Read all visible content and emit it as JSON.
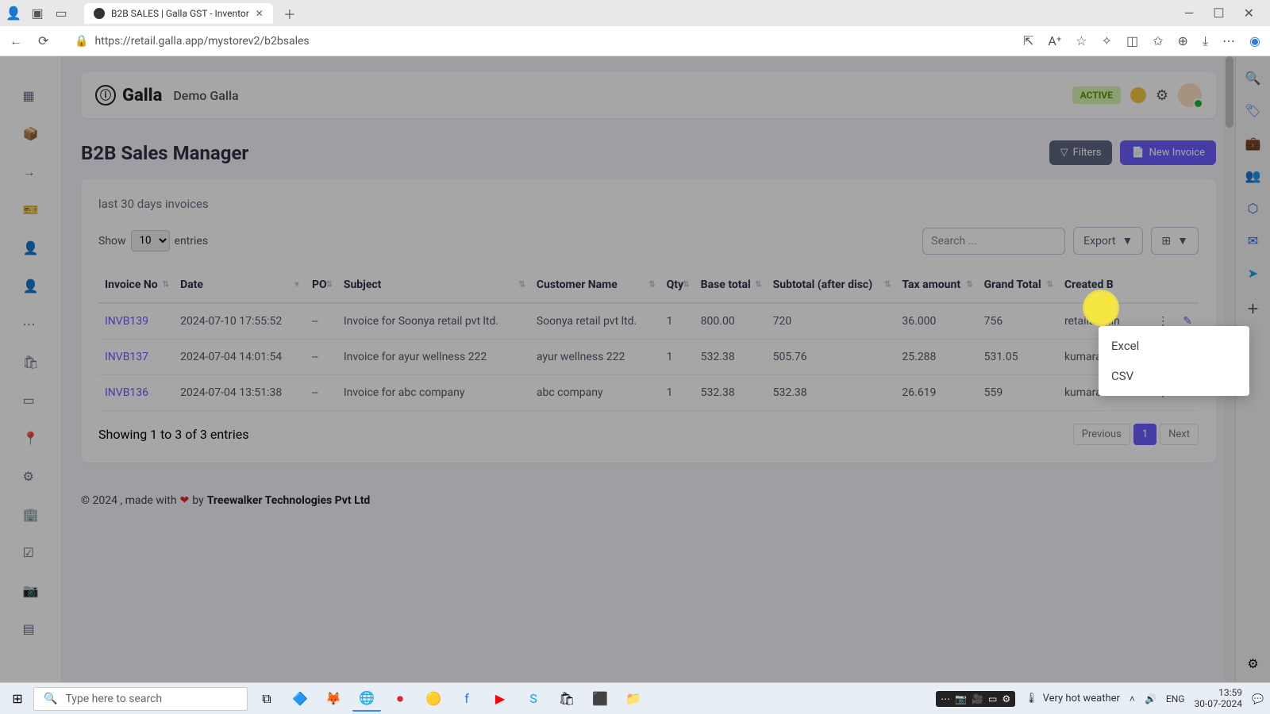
{
  "browser": {
    "tab_title": "B2B SALES | Galla GST - Inventor",
    "url": "https://retail.galla.app/mystorev2/b2bsales"
  },
  "header": {
    "app_name": "Galla",
    "store_name": "Demo Galla",
    "status_badge": "ACTIVE"
  },
  "page": {
    "title": "B2B Sales Manager",
    "filters_btn": "Filters",
    "new_invoice_btn": "New Invoice"
  },
  "card": {
    "subtitle": "last 30 days invoices",
    "show_label": "Show",
    "entries_label": "entries",
    "entries_value": "10",
    "search_placeholder": "Search ...",
    "export_label": "Export"
  },
  "export_menu": {
    "excel": "Excel",
    "csv": "CSV"
  },
  "table": {
    "headers": {
      "invoice_no": "Invoice No",
      "date": "Date",
      "po": "PO",
      "subject": "Subject",
      "customer": "Customer Name",
      "qty": "Qty",
      "base_total": "Base total",
      "subtotal": "Subtotal (after disc)",
      "tax": "Tax amount",
      "grand": "Grand Total",
      "created_by": "Created B"
    },
    "rows": [
      {
        "inv": "INVB139",
        "date": "2024-07-10 17:55:52",
        "po": "--",
        "subject": "Invoice for Soonya retail pvt ltd.",
        "customer": "Soonya retail pvt ltd.",
        "qty": "1",
        "base": "800.00",
        "sub": "720",
        "tax": "36.000",
        "grand": "756",
        "by": "retailadmin"
      },
      {
        "inv": "INVB137",
        "date": "2024-07-04 14:01:54",
        "po": "--",
        "subject": "Invoice for ayur wellness 222",
        "customer": "ayur wellness 222",
        "qty": "1",
        "base": "532.38",
        "sub": "505.76",
        "tax": "25.288",
        "grand": "531.05",
        "by": "kumaradmin"
      },
      {
        "inv": "INVB136",
        "date": "2024-07-04 13:51:38",
        "po": "--",
        "subject": "Invoice for abc company",
        "customer": "abc company",
        "qty": "1",
        "base": "532.38",
        "sub": "532.38",
        "tax": "26.619",
        "grand": "559",
        "by": "kumaradmin"
      }
    ]
  },
  "pager": {
    "showing": "Showing 1 to 3 of 3 entries",
    "prev": "Previous",
    "page": "1",
    "next": "Next"
  },
  "footer": {
    "prefix": "© 2024 , made with ",
    "by": " by ",
    "company": "Treewalker Technologies Pvt Ltd"
  },
  "taskbar": {
    "search_placeholder": "Type here to search",
    "weather": "Very hot weather",
    "lang": "ENG",
    "time": "13:59",
    "date": "30-07-2024"
  }
}
